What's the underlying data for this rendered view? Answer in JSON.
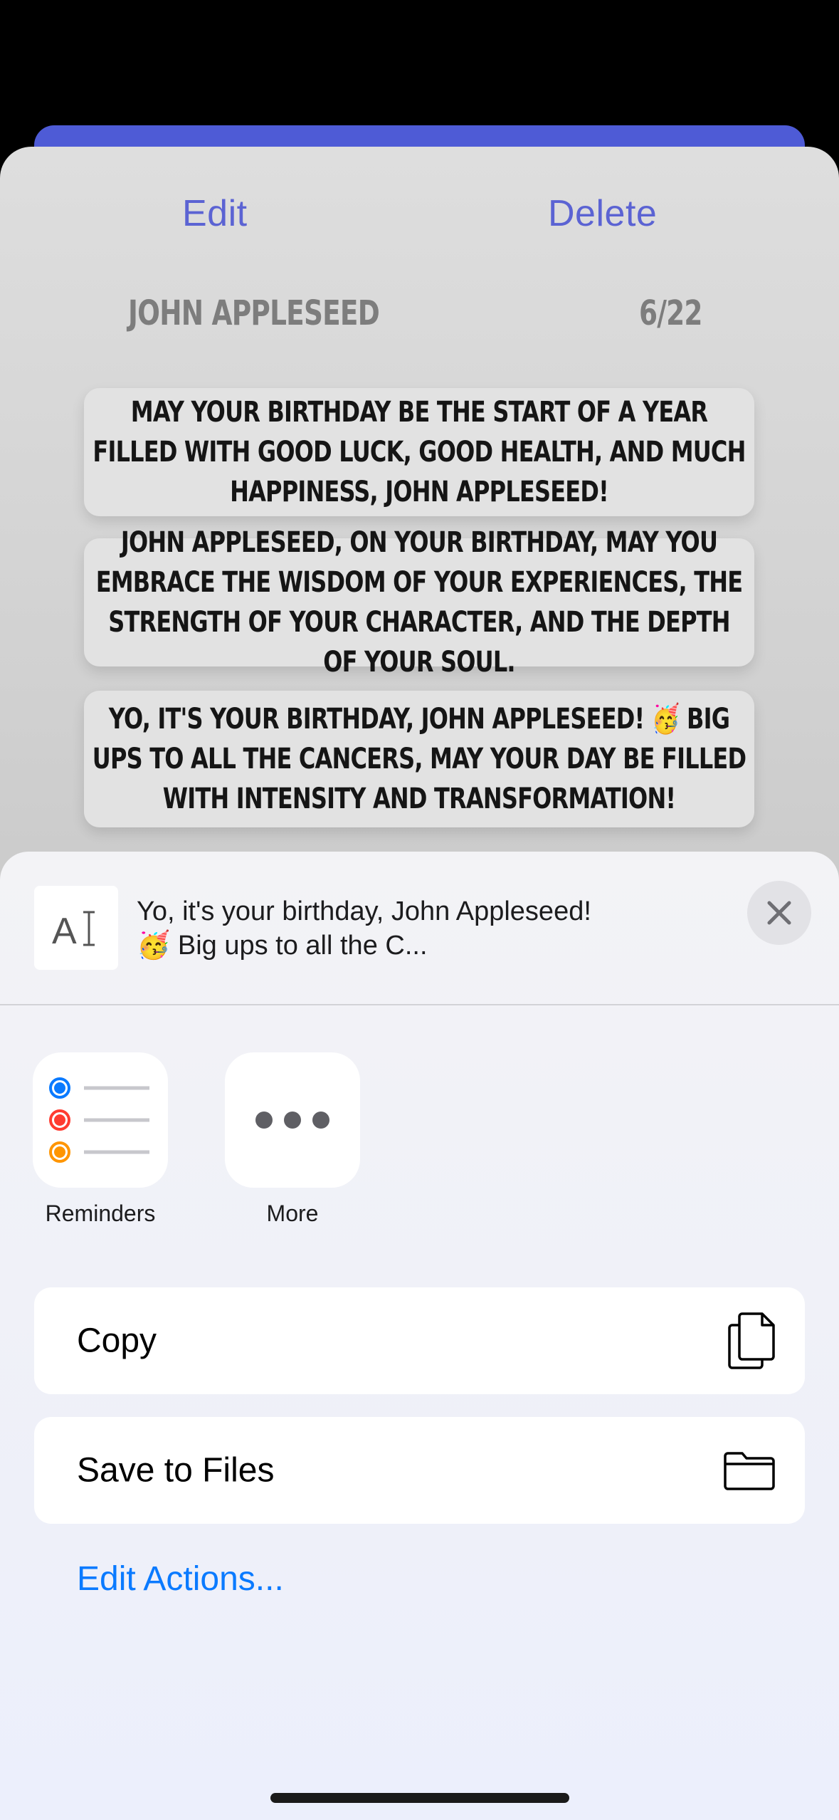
{
  "detail": {
    "edit_label": "Edit",
    "delete_label": "Delete",
    "contact_name": "JOHN APPLESEED",
    "birthday": "6/22",
    "messages": [
      "May your birthday be the start of a year filled with good luck, good health, and much happiness, John Appleseed!",
      "John Appleseed, on your birthday, may you embrace the wisdom of your experiences, the strength of your character, and the depth of your soul.",
      "Yo, it's your birthday, John Appleseed! 🥳 Big ups to all the Cancers, may your day be filled with intensity and transformation!"
    ]
  },
  "share_sheet": {
    "preview_text": "Yo, it's your birthday, John Appleseed! 🥳 Big ups to all the C...",
    "preview_thumb_glyph": "AI",
    "apps": [
      {
        "label": "Reminders",
        "icon": "reminders-icon"
      },
      {
        "label": "More",
        "icon": "more-icon"
      }
    ],
    "actions": [
      {
        "label": "Copy",
        "icon": "copy-icon"
      },
      {
        "label": "Save to Files",
        "icon": "folder-icon"
      }
    ],
    "edit_actions_label": "Edit Actions..."
  },
  "colors": {
    "accent_blue": "#0A7AFF",
    "app_purple": "#5B63D3",
    "sheet_edge": "#4E5BD6"
  }
}
